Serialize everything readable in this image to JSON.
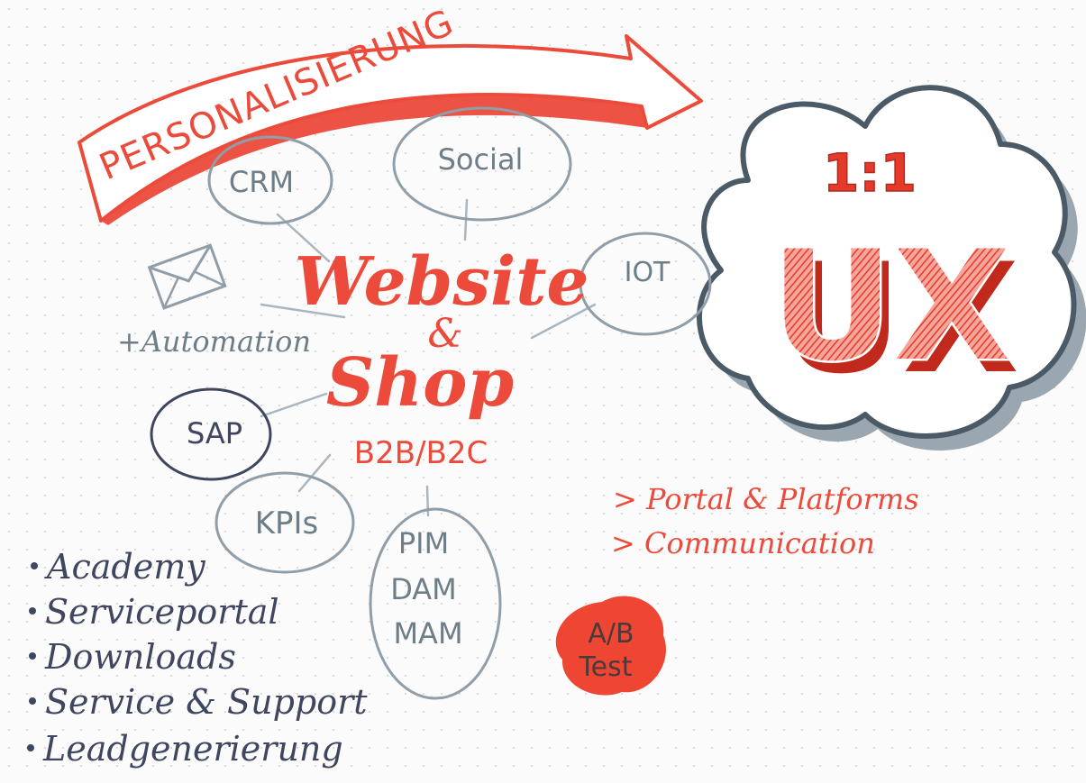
{
  "arrow_label": "PERSONALISIERUNG",
  "center": {
    "title_line1": "Website",
    "title_amp": "&",
    "title_line2": "Shop",
    "subtitle": "B2B/B2C"
  },
  "bubbles": {
    "crm": "CRM",
    "social": "Social",
    "iot": "IOT",
    "sap": "SAP",
    "kpis": "KPIs",
    "pim": "PIM",
    "dam": "DAM",
    "mam": "MAM"
  },
  "email": {
    "label": "+Automation"
  },
  "cloud": {
    "ratio": "1:1",
    "ux": "UX"
  },
  "channels": [
    "> Portal & Platforms",
    "> Communication"
  ],
  "ab_test": {
    "line1": "A/B",
    "line2": "Test"
  },
  "features": [
    "Academy",
    "Serviceportal",
    "Downloads",
    "Service & Support",
    "Leadgenerierung"
  ],
  "colors": {
    "accent": "#ec4a3a",
    "gray": "#6e7e88",
    "navy": "#3e4660",
    "cloud_shadow": "#8c9aa4"
  }
}
